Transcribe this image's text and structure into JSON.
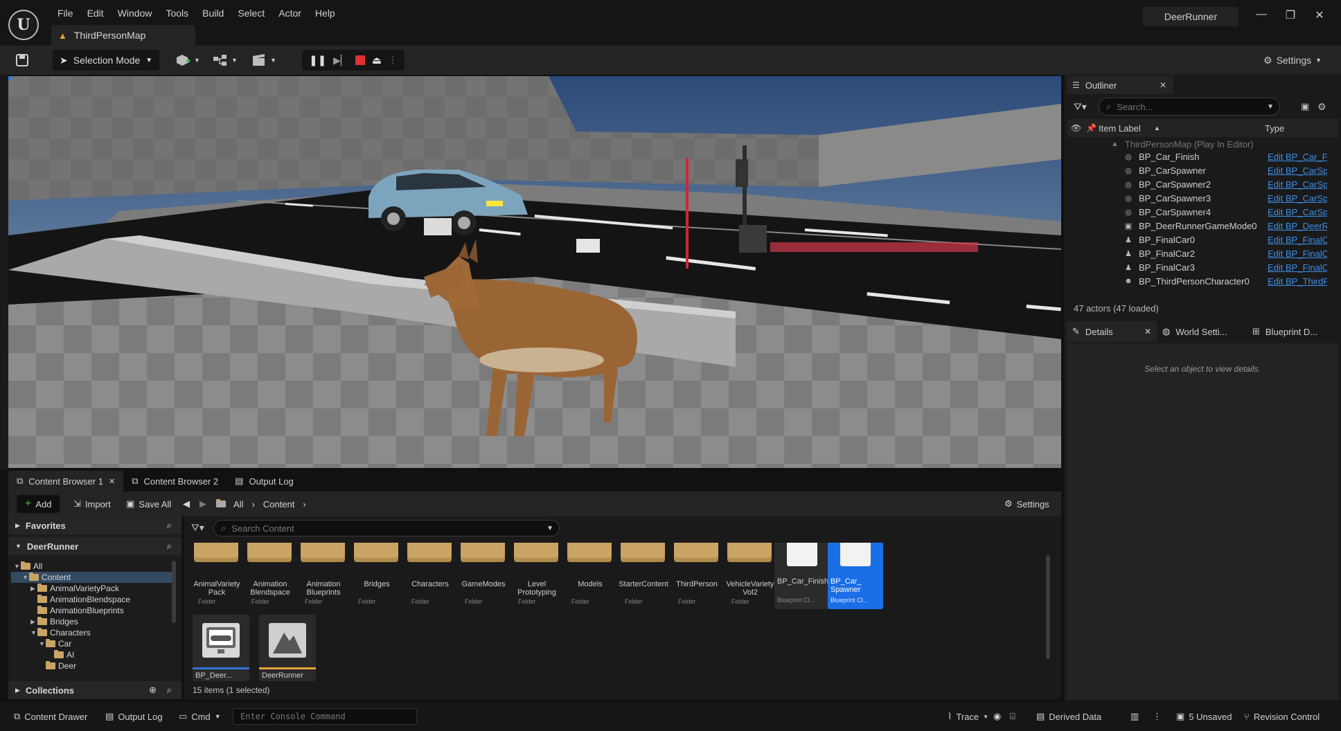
{
  "app": {
    "project": "DeerRunner",
    "map_tab": "ThirdPersonMap",
    "logo": "unreal-logo"
  },
  "menu": [
    "File",
    "Edit",
    "Window",
    "Tools",
    "Build",
    "Select",
    "Actor",
    "Help"
  ],
  "toolbar": {
    "selection_mode": "Selection Mode",
    "settings": "Settings"
  },
  "outliner": {
    "tab": "Outliner",
    "search_placeholder": "Search...",
    "col_label": "Item Label",
    "col_type": "Type",
    "root": "ThirdPersonMap (Play In Editor)",
    "rows": [
      {
        "label": "BP_Car_Finish",
        "type": "Edit BP_Car_Fi",
        "icon": "blueprint-actor-icon"
      },
      {
        "label": "BP_CarSpawner",
        "type": "Edit BP_CarSp",
        "icon": "blueprint-actor-icon"
      },
      {
        "label": "BP_CarSpawner2",
        "type": "Edit BP_CarSp",
        "icon": "blueprint-actor-icon"
      },
      {
        "label": "BP_CarSpawner3",
        "type": "Edit BP_CarSp",
        "icon": "blueprint-actor-icon"
      },
      {
        "label": "BP_CarSpawner4",
        "type": "Edit BP_CarSp",
        "icon": "blueprint-actor-icon"
      },
      {
        "label": "BP_DeerRunnerGameMode0",
        "type": "Edit BP_DeerR",
        "icon": "game-mode-icon"
      },
      {
        "label": "BP_FinalCar0",
        "type": "Edit BP_FinalC",
        "icon": "pawn-icon"
      },
      {
        "label": "BP_FinalCar2",
        "type": "Edit BP_FinalC",
        "icon": "pawn-icon"
      },
      {
        "label": "BP_FinalCar3",
        "type": "Edit BP_FinalC",
        "icon": "pawn-icon"
      },
      {
        "label": "BP_ThirdPersonCharacter0",
        "type": "Edit BP_ThirdF",
        "icon": "character-icon"
      }
    ],
    "actor_count": "47 actors (47 loaded)"
  },
  "details": {
    "tabs": [
      "Details",
      "World Setti...",
      "Blueprint D..."
    ],
    "message": "Select an object to view details."
  },
  "bottom_tabs": [
    "Content Browser 1",
    "Content Browser 2",
    "Output Log"
  ],
  "content_browser": {
    "add": "Add",
    "import": "Import",
    "save_all": "Save All",
    "path": [
      "All",
      "Content"
    ],
    "settings": "Settings",
    "favorites": "Favorites",
    "project": "DeerRunner",
    "collections": "Collections",
    "search_placeholder": "Search Content",
    "tree": [
      {
        "label": "All",
        "depth": 0,
        "open": true
      },
      {
        "label": "Content",
        "depth": 1,
        "open": true,
        "selected": true
      },
      {
        "label": "AnimalVarietyPack",
        "depth": 2,
        "open": false
      },
      {
        "label": "AnimationBlendspace",
        "depth": 2,
        "open": null
      },
      {
        "label": "AnimationBlueprints",
        "depth": 2,
        "open": null
      },
      {
        "label": "Bridges",
        "depth": 2,
        "open": false
      },
      {
        "label": "Characters",
        "depth": 2,
        "open": true
      },
      {
        "label": "Car",
        "depth": 3,
        "open": true
      },
      {
        "label": "AI",
        "depth": 4,
        "open": null
      },
      {
        "label": "Deer",
        "depth": 3,
        "open": null
      }
    ],
    "folders": [
      {
        "name": "AnimalVariety Pack",
        "type": "Folder"
      },
      {
        "name": "Animation Blendspace",
        "type": "Folder"
      },
      {
        "name": "Animation Blueprints",
        "type": "Folder"
      },
      {
        "name": "Bridges",
        "type": "Folder"
      },
      {
        "name": "Characters",
        "type": "Folder"
      },
      {
        "name": "GameModes",
        "type": "Folder"
      },
      {
        "name": "Level Prototyping",
        "type": "Folder"
      },
      {
        "name": "Models",
        "type": "Folder"
      },
      {
        "name": "StarterContent",
        "type": "Folder"
      },
      {
        "name": "ThirdPerson",
        "type": "Folder"
      },
      {
        "name": "VehicleVariety Vol2",
        "type": "Folder"
      }
    ],
    "blueprints": [
      {
        "name": "BP_Car_Finish",
        "type": "Blueprint Cl..."
      },
      {
        "name": "BP_Car_ Spawner",
        "type": "Blueprint Cl..."
      }
    ],
    "extra_assets": [
      {
        "name": "BP_Deer...",
        "icon": "gamepad-icon",
        "accent": "#2d74d9"
      },
      {
        "name": "DeerRunner",
        "icon": "map-icon",
        "accent": "#e8a33a"
      }
    ],
    "item_count": "15 items (1 selected)"
  },
  "statusbar": {
    "content_drawer": "Content Drawer",
    "output_log": "Output Log",
    "cmd": "Cmd",
    "console_placeholder": "Enter Console Command",
    "trace": "Trace",
    "derived_data": "Derived Data",
    "unsaved": "5 Unsaved",
    "revision_control": "Revision Control"
  },
  "colors": {
    "accent": "#1a6ee6",
    "link": "#3d8fe8",
    "folder": "#c9a464",
    "stop": "#e03030"
  }
}
